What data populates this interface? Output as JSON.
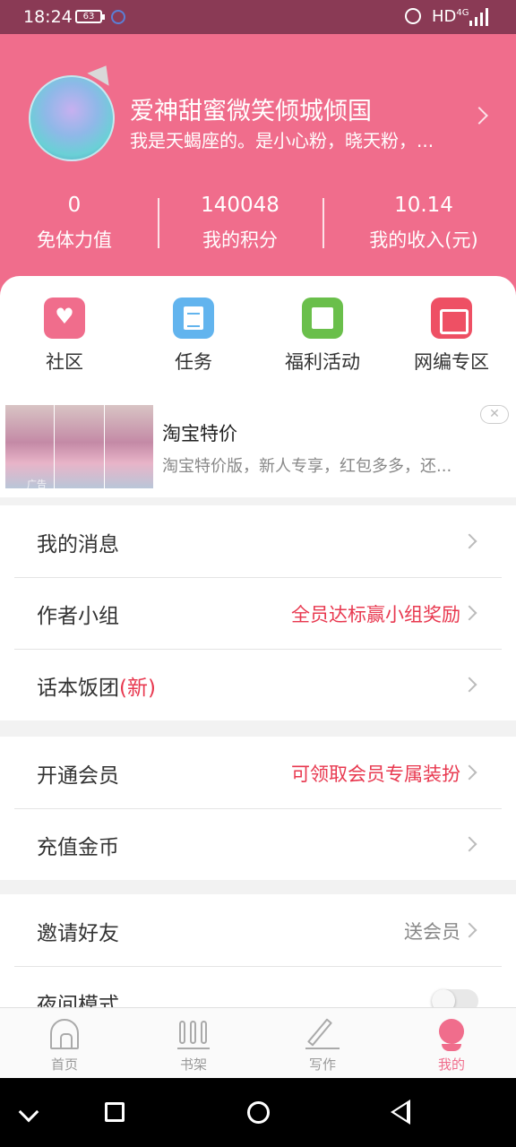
{
  "status_bar": {
    "time": "18:24",
    "battery": "63",
    "network": "HD",
    "network_sub": "4G"
  },
  "profile": {
    "username": "爱神甜蜜微笑倾城倾国",
    "bio": "我是天蝎座的。是小心粉，晓天粉，..."
  },
  "stats": [
    {
      "value": "0",
      "label": "免体力值"
    },
    {
      "value": "140048",
      "label": "我的积分"
    },
    {
      "value": "10.14",
      "label": "我的收入(元)"
    }
  ],
  "quick_actions": [
    {
      "label": "社区",
      "icon": "heart-icon",
      "color": "#f06d8c"
    },
    {
      "label": "任务",
      "icon": "task-list-icon",
      "color": "#62b4ee"
    },
    {
      "label": "福利活动",
      "icon": "newspaper-icon",
      "color": "#6abf4b"
    },
    {
      "label": "网编专区",
      "icon": "gift-icon",
      "color": "#ee5064"
    }
  ],
  "ad": {
    "title": "淘宝特价",
    "description": "淘宝特价版，新人专享，红包多多，还...",
    "tag": "广告",
    "close": "✕"
  },
  "menu_groups": [
    [
      {
        "title": "我的消息",
        "extra": ""
      },
      {
        "title": "作者小组",
        "extra": "全员达标赢小组奖励"
      },
      {
        "title": "话本饭团",
        "badge": "(新)",
        "extra": ""
      }
    ],
    [
      {
        "title": "开通会员",
        "extra": "可领取会员专属装扮"
      },
      {
        "title": "充值金币",
        "extra": ""
      }
    ],
    [
      {
        "title": "邀请好友",
        "extra": "送会员"
      },
      {
        "title": "夜间模式",
        "toggle": false
      }
    ]
  ],
  "tabs": [
    {
      "label": "首页",
      "icon": "home-icon"
    },
    {
      "label": "书架",
      "icon": "bookshelf-icon"
    },
    {
      "label": "写作",
      "icon": "pen-icon"
    },
    {
      "label": "我的",
      "icon": "me-icon",
      "active": true
    }
  ],
  "colors": {
    "brand": "#f06d8c",
    "status_bar": "#8a3a55",
    "highlight": "#e8384f"
  }
}
